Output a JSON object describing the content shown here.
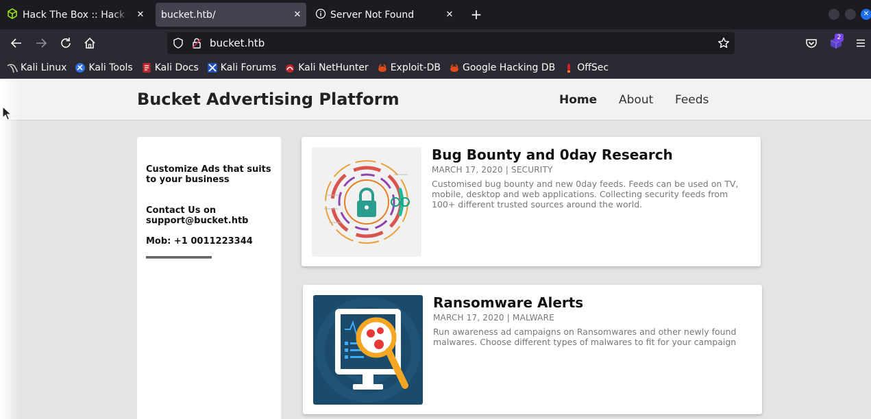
{
  "browser": {
    "tabs": [
      {
        "title": "Hack The Box :: Hack The Box",
        "icon": "htb-cube-icon"
      },
      {
        "title": "bucket.htb/",
        "active": true
      },
      {
        "title": "Server Not Found",
        "icon": "info-icon"
      }
    ],
    "url": "bucket.htb",
    "extension_badge": "2",
    "bookmarks": [
      {
        "label": "Kali Linux",
        "icon": "kali-dragon-icon"
      },
      {
        "label": "Kali Tools",
        "icon": "kali-tools-icon"
      },
      {
        "label": "Kali Docs",
        "icon": "kali-docs-icon"
      },
      {
        "label": "Kali Forums",
        "icon": "kali-forums-icon"
      },
      {
        "label": "Kali NetHunter",
        "icon": "nethunter-icon"
      },
      {
        "label": "Exploit-DB",
        "icon": "exploit-db-icon"
      },
      {
        "label": "Google Hacking DB",
        "icon": "ghdb-icon"
      },
      {
        "label": "OffSec",
        "icon": "offsec-icon"
      }
    ]
  },
  "site": {
    "brand": "Bucket Advertising Platform",
    "nav": {
      "home": "Home",
      "about": "About",
      "feeds": "Feeds"
    },
    "sidebar": {
      "tagline": "Customize Ads that suits to your business",
      "contact": "Contact Us on support@bucket.htb",
      "mobile": "Mob: +1 0011223344"
    },
    "posts": [
      {
        "title": "Bug Bounty and 0day Research",
        "meta": "MARCH 17, 2020 | SECURITY",
        "body": "Customised bug bounty and new 0day feeds. Feeds can be used on TV, mobile, desktop and web applications. Collecting security feeds from 100+ different trusted sources around the world.",
        "image": "security-lock-illustration"
      },
      {
        "title": "Ransomware Alerts",
        "meta": "MARCH 17, 2020 | MALWARE",
        "body": "Run awareness ad campaigns on Ransomwares and other newly found malwares. Choose different types of malwares to fit for your campaign",
        "image": "malware-scan-illustration"
      }
    ]
  },
  "colors": {
    "browser_bg": "#1c1b22",
    "toolbar_bg": "#2b2a33",
    "active_tab": "#42414d",
    "page_bg": "#e4e4e4",
    "header_bg": "#f2f2f2",
    "muted_text": "#777777",
    "malware_bg": "#1b4a6b"
  }
}
